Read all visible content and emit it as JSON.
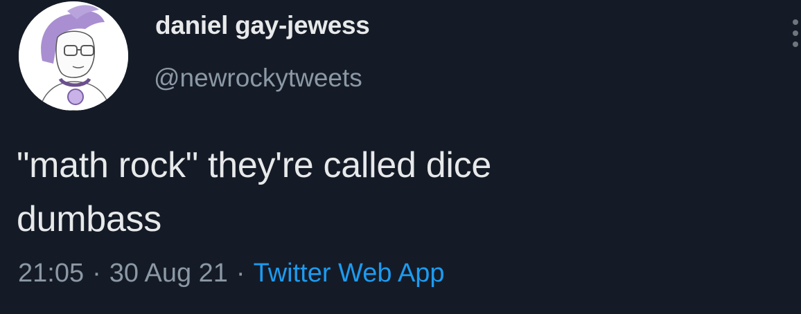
{
  "user": {
    "display_name": "daniel gay-jewess",
    "handle": "@newrockytweets",
    "avatar_icon": "cartoon-person-avatar"
  },
  "tweet": {
    "text": "\"math rock\" they're called dice\ndumbass",
    "time": "21:05",
    "date": "30 Aug 21",
    "source": "Twitter Web App",
    "separator": "·"
  },
  "colors": {
    "background": "#151b26",
    "text": "#e7e9ea",
    "secondary": "#8b98a5",
    "link": "#1d9bf0"
  }
}
